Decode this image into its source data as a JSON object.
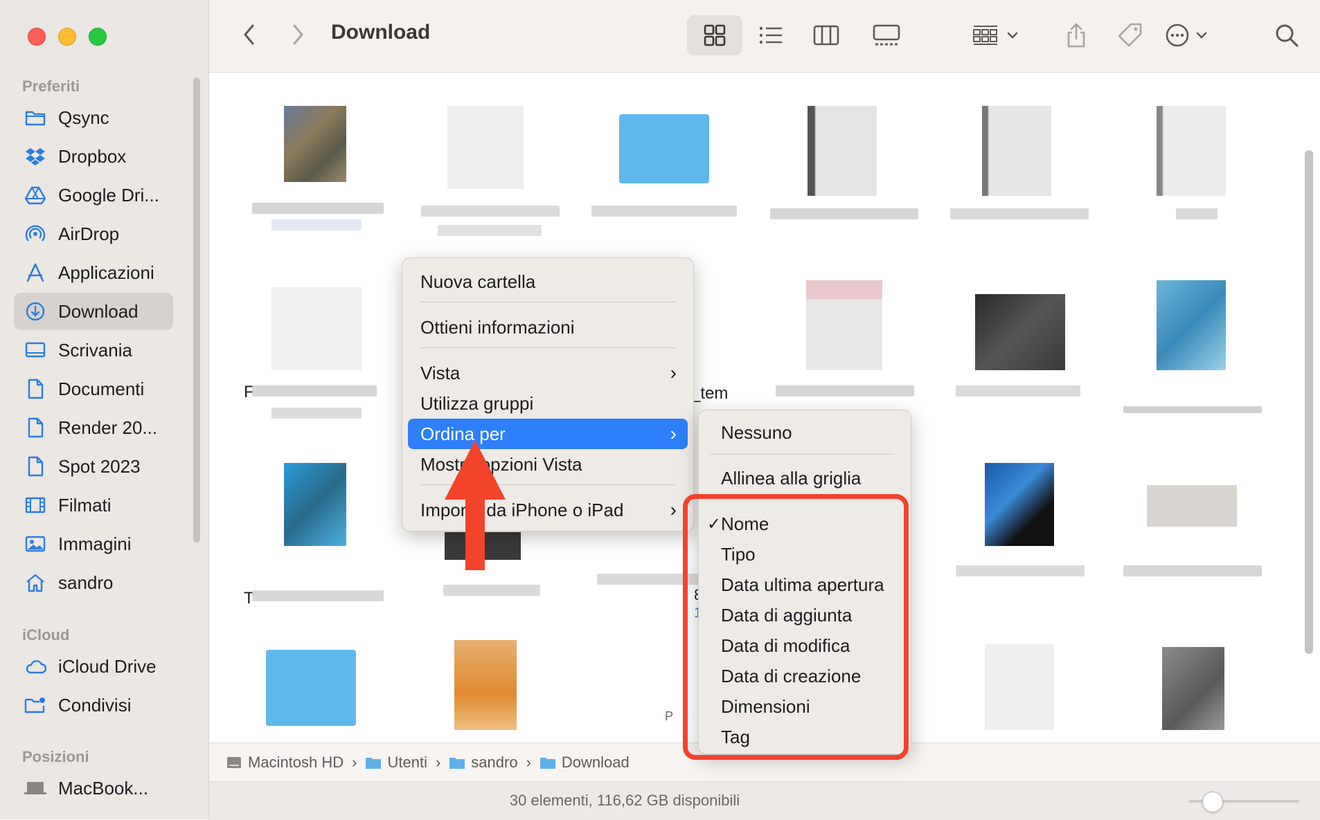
{
  "window": {
    "title": "Download"
  },
  "sidebar": {
    "sections": [
      {
        "heading": "Preferiti",
        "items": [
          {
            "label": "Qsync",
            "icon": "folder-icon"
          },
          {
            "label": "Dropbox",
            "icon": "dropbox-icon"
          },
          {
            "label": "Google Dri...",
            "icon": "google-drive-icon"
          },
          {
            "label": "AirDrop",
            "icon": "airdrop-icon"
          },
          {
            "label": "Applicazioni",
            "icon": "applications-icon"
          },
          {
            "label": "Download",
            "icon": "download-icon",
            "active": true
          },
          {
            "label": "Scrivania",
            "icon": "desktop-icon"
          },
          {
            "label": "Documenti",
            "icon": "document-icon"
          },
          {
            "label": "Render 20...",
            "icon": "document-icon"
          },
          {
            "label": "Spot 2023",
            "icon": "document-icon"
          },
          {
            "label": "Filmati",
            "icon": "film-icon"
          },
          {
            "label": "Immagini",
            "icon": "photo-icon"
          },
          {
            "label": "sandro",
            "icon": "home-icon"
          }
        ]
      },
      {
        "heading": "iCloud",
        "items": [
          {
            "label": "iCloud Drive",
            "icon": "cloud-icon"
          },
          {
            "label": "Condivisi",
            "icon": "shared-folder-icon"
          }
        ]
      },
      {
        "heading": "Posizioni",
        "items": [
          {
            "label": "MacBook...",
            "icon": "laptop-icon"
          }
        ]
      }
    ]
  },
  "context_menu": {
    "items": [
      {
        "label": "Nuova cartella"
      },
      {
        "label": "Ottieni informazioni"
      },
      {
        "label": "Vista",
        "submenu": true
      },
      {
        "label": "Utilizza gruppi"
      },
      {
        "label": "Ordina per",
        "submenu": true,
        "selected": true
      },
      {
        "label": "Mostra opzioni Vista"
      },
      {
        "label": "Importa da iPhone o iPad",
        "submenu": true
      }
    ]
  },
  "submenu": {
    "items": [
      {
        "label": "Nessuno"
      },
      {
        "label": "Allinea alla griglia"
      },
      {
        "label": "Nome",
        "checked": true
      },
      {
        "label": "Tipo"
      },
      {
        "label": "Data ultima apertura"
      },
      {
        "label": "Data di aggiunta"
      },
      {
        "label": "Data di modifica"
      },
      {
        "label": "Data di creazione"
      },
      {
        "label": "Dimensioni"
      },
      {
        "label": "Tag"
      }
    ]
  },
  "file_fragments": {
    "a": "_tem",
    "b": "F",
    "c": "T",
    "d": "8",
    "e": "1.",
    "f": "P"
  },
  "pathbar": {
    "crumbs": [
      "Macintosh HD",
      "Utenti",
      "sandro",
      "Download"
    ]
  },
  "status": {
    "text": "30 elementi, 116,62 GB disponibili"
  },
  "colors": {
    "accent": "#2d7ff9",
    "highlight_box": "#f2432b",
    "arrow": "#f2432b"
  }
}
